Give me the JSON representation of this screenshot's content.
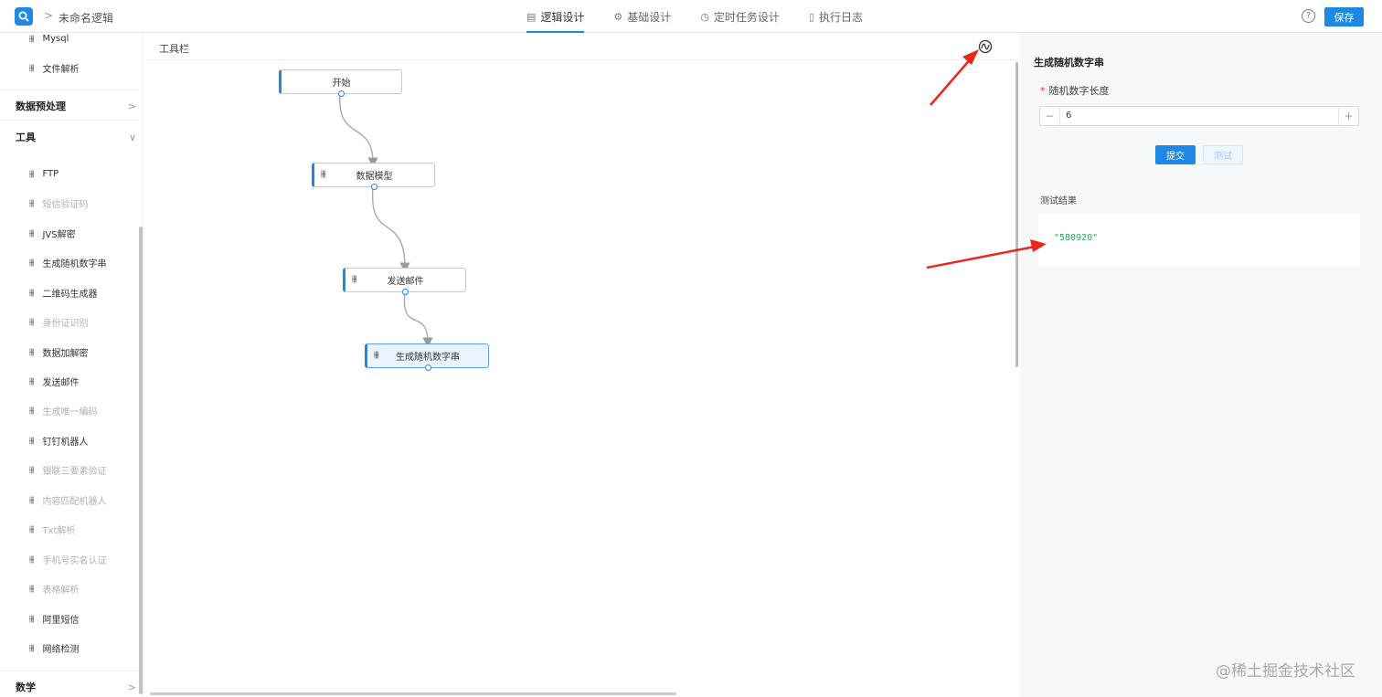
{
  "header": {
    "app_title": "未命名逻辑",
    "crumb_sep": ">",
    "tabs": [
      {
        "label": "逻辑设计",
        "icon": "document-icon",
        "glyph": "▤",
        "active": true
      },
      {
        "label": "基础设计",
        "icon": "gear-icon",
        "glyph": "⚙",
        "active": false
      },
      {
        "label": "定时任务设计",
        "icon": "clock-icon",
        "glyph": "◷",
        "active": false
      },
      {
        "label": "执行日志",
        "icon": "file-icon",
        "glyph": "▯",
        "active": false
      }
    ],
    "help_glyph": "?",
    "save_label": "保存",
    "accent": "#1e88e5"
  },
  "sidebar": {
    "item_glyph": "⫲⫲",
    "top_items": [
      {
        "label": "Mysql",
        "muted": false
      },
      {
        "label": "文件解析",
        "muted": false
      }
    ],
    "groups": [
      {
        "label": "数据预处理",
        "chevron": ">"
      },
      {
        "label": "工具",
        "chevron": "∨"
      },
      {
        "label": "数学",
        "chevron": ">"
      }
    ],
    "tool_items": [
      {
        "label": "FTP",
        "muted": false
      },
      {
        "label": "短信验证码",
        "muted": true
      },
      {
        "label": "JVS解密",
        "muted": false
      },
      {
        "label": "生成随机数字串",
        "muted": false
      },
      {
        "label": "二维码生成器",
        "muted": false
      },
      {
        "label": "身份证识别",
        "muted": true
      },
      {
        "label": "数据加解密",
        "muted": false
      },
      {
        "label": "发送邮件",
        "muted": false
      },
      {
        "label": "生成唯一编码",
        "muted": true
      },
      {
        "label": "钉钉机器人",
        "muted": false
      },
      {
        "label": "银联三要素验证",
        "muted": true
      },
      {
        "label": "内容匹配机器人",
        "muted": true
      },
      {
        "label": "Txt解析",
        "muted": true
      },
      {
        "label": "手机号实名认证",
        "muted": true
      },
      {
        "label": "表格解析",
        "muted": true
      },
      {
        "label": "阿里短信",
        "muted": false
      },
      {
        "label": "网络检测",
        "muted": false
      }
    ]
  },
  "canvas": {
    "toolbar_label": "工具栏",
    "nodes": [
      {
        "label": "开始",
        "has_icon": false,
        "selected": false
      },
      {
        "label": "数据模型",
        "has_icon": true,
        "selected": false
      },
      {
        "label": "发送邮件",
        "has_icon": true,
        "selected": false
      },
      {
        "label": "生成随机数字串",
        "has_icon": true,
        "selected": true
      }
    ],
    "node_glyph": "⫲⫲"
  },
  "panel": {
    "title": "生成随机数字串",
    "required_mark": "*",
    "field_label": "随机数字长度",
    "minus": "−",
    "plus": "+",
    "value": "6",
    "submit_label": "提交",
    "test_label": "测试",
    "result_label": "测试结果",
    "result_value": "\"580920\""
  },
  "watermark": "@稀土掘金技术社区",
  "annotation_color": "#e8281e"
}
